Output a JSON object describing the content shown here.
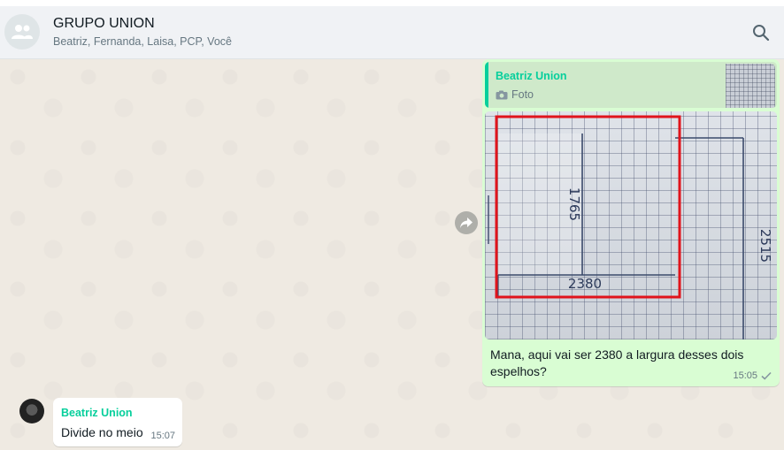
{
  "header": {
    "title": "GRUPO UNION",
    "members": "Beatriz, Fernanda, Laisa, PCP, Você",
    "avatar_icon": "group-icon",
    "search_icon": "search-icon"
  },
  "outgoing": {
    "quote": {
      "author": "Beatriz Union",
      "type_label": "Foto",
      "type_icon": "camera-icon"
    },
    "photo": {
      "annotations": [
        "1765",
        "2380",
        "2515"
      ]
    },
    "text": "Mana, aqui vai ser 2380 a largura desses dois espelhos?",
    "time": "15:05",
    "status_icon": "single-check-icon"
  },
  "incoming": {
    "author": "Beatriz Union",
    "text": "Divide no meio",
    "time": "15:07"
  },
  "colors": {
    "outgoing_bubble": "#d9fdd3",
    "author_green": "#06cf9c",
    "chat_bg": "#efeae2",
    "highlight_red": "#e0141c"
  }
}
